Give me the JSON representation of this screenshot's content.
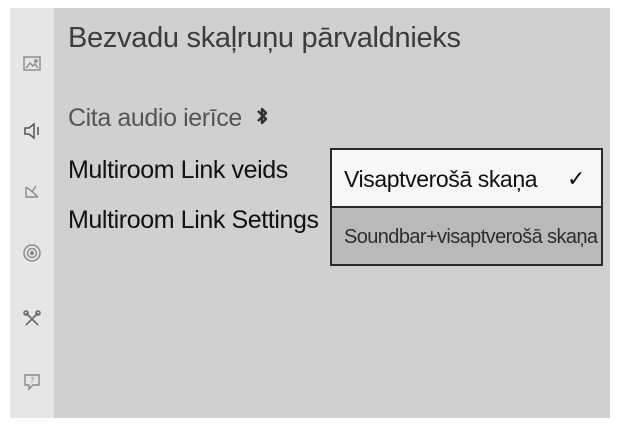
{
  "panel": {
    "title": "Bezvadu skaļruņu pārvaldnieks"
  },
  "menu": {
    "items": [
      {
        "label": "Cita audio ierīce",
        "has_bluetooth_icon": true
      },
      {
        "label": "Multiroom Link veids"
      },
      {
        "label": "Multiroom Link Settings"
      }
    ]
  },
  "dropdown": {
    "options": [
      {
        "label": "Visaptverošā skaņa",
        "selected": true
      },
      {
        "label": "Soundbar+visaptverošā skaņa",
        "selected": false
      }
    ],
    "check_mark": "✓"
  },
  "sidebar": {
    "icons": [
      "picture-icon",
      "sound-icon",
      "broadcast-icon",
      "network-icon",
      "system-icon",
      "support-icon"
    ]
  },
  "colors": {
    "panel_bg": "#d0d0d0",
    "sidebar_bg": "#e6e6e6",
    "dropdown_selected_bg": "#f7f7f7",
    "dropdown_other_bg": "#b9b9b9"
  }
}
